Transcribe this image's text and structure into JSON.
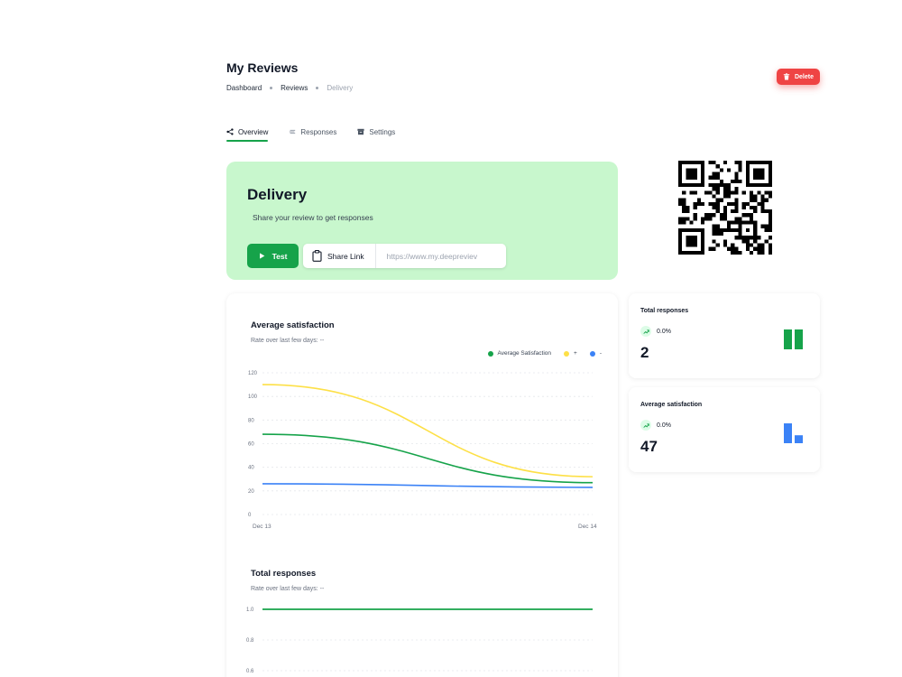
{
  "header": {
    "title": "My Reviews",
    "breadcrumb": [
      "Dashboard",
      "Reviews",
      "Delivery"
    ],
    "delete_label": "Delete"
  },
  "tabs": [
    {
      "label": "Overview",
      "icon": "share-nodes-icon",
      "active": true
    },
    {
      "label": "Responses",
      "icon": "list-icon",
      "active": false
    },
    {
      "label": "Settings",
      "icon": "archive-icon",
      "active": false
    }
  ],
  "hero": {
    "title": "Delivery",
    "subtitle": "Share your review to get responses",
    "test_label": "Test",
    "share_label": "Share Link",
    "share_url": "https://www.my.deepreviev"
  },
  "colors": {
    "accent": "#16a34a",
    "hero_bg": "#c8f7cd",
    "danger": "#ef4444",
    "series_green": "#16a34a",
    "series_yellow": "#fde047",
    "series_blue": "#3b82f6"
  },
  "avg_chart": {
    "title": "Average satisfaction",
    "subtitle": "Rate over last few days: --"
  },
  "resp_chart": {
    "title": "Total responses",
    "subtitle": "Rate over last few days: --"
  },
  "chart_data": [
    {
      "type": "line",
      "title": "Average satisfaction",
      "x": [
        "Dec 13",
        "Dec 14"
      ],
      "y_ticks": [
        0,
        20,
        40,
        60,
        80,
        100,
        120
      ],
      "y_tick_labels": [
        "0",
        "20",
        "40",
        "60",
        "80",
        "100",
        "120"
      ],
      "ylim": [
        0,
        120
      ],
      "grid": true,
      "legend": "top-right",
      "series": [
        {
          "name": "Average Satisfaction",
          "color": "#16a34a",
          "values": [
            68,
            27
          ]
        },
        {
          "name": "+",
          "color": "#fde047",
          "values": [
            110,
            32
          ]
        },
        {
          "name": "-",
          "color": "#3b82f6",
          "values": [
            26,
            23
          ]
        }
      ]
    },
    {
      "type": "line",
      "title": "Total responses",
      "y_ticks": [
        0.6,
        0.8,
        1.0
      ],
      "y_tick_labels": [
        "0.6",
        "0.8",
        "1.0"
      ],
      "ylim": [
        0.6,
        1.0
      ],
      "grid": true,
      "series": [
        {
          "color": "#16a34a",
          "values": [
            1.0,
            1.0
          ]
        }
      ]
    }
  ],
  "stats": [
    {
      "label": "Total responses",
      "trend": "0.0%",
      "value": "2",
      "bars_color": "#16a34a",
      "bars": [
        1.0,
        1.0
      ]
    },
    {
      "label": "Average satisfaction",
      "trend": "0.0%",
      "value": "47",
      "bars_color": "#3b82f6",
      "bars": [
        1.0,
        0.4
      ]
    }
  ]
}
